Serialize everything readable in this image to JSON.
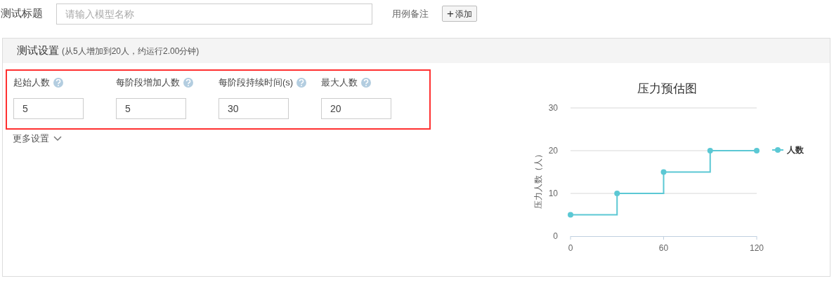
{
  "header": {
    "title_label": "测试标题",
    "title_placeholder": "请输入模型名称",
    "remark_label": "用例备注",
    "add_button": {
      "icon": "+",
      "label": "添加"
    }
  },
  "settings": {
    "title": "测试设置",
    "summary": "(从5人增加到20人，约运行2.00分钟)",
    "fields": [
      {
        "label": "起始人数",
        "value": "5"
      },
      {
        "label": "每阶段增加人数",
        "value": "5"
      },
      {
        "label": "每阶段持续时间(s)",
        "value": "30"
      },
      {
        "label": "最大人数",
        "value": "20"
      }
    ],
    "more": "更多设置",
    "chart": {
      "chart_data": {
        "type": "line",
        "title": "压力预估图",
        "ylabel": "压力人数（人）",
        "x": [
          0,
          30,
          30,
          60,
          60,
          90,
          90,
          120
        ],
        "series": [
          {
            "name": "人数",
            "color": "#5bc8d4",
            "marker": "circle",
            "values": [
              5,
              5,
              10,
              10,
              15,
              15,
              20,
              20
            ]
          }
        ],
        "xlim": [
          0,
          120
        ],
        "ylim": [
          0,
          30
        ],
        "xticks": [
          0,
          60,
          120
        ],
        "yticks": [
          0,
          10,
          20,
          30
        ]
      }
    }
  }
}
